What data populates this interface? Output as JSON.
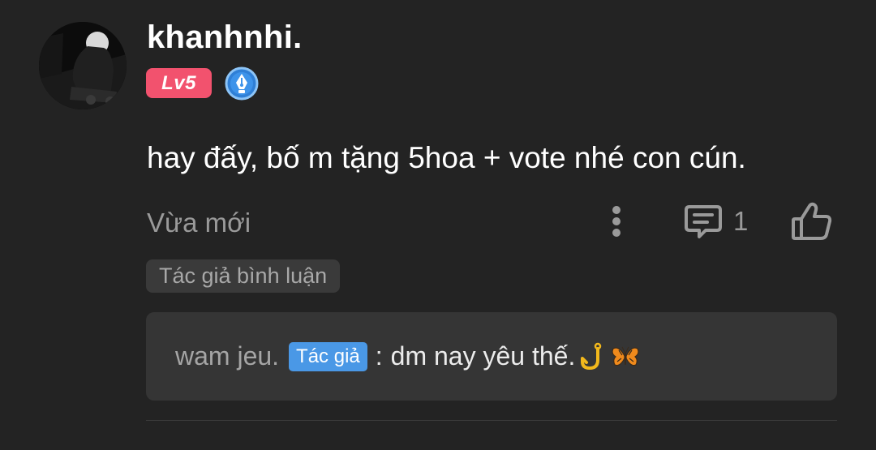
{
  "comment": {
    "username": "khanhnhi.",
    "level": "Lv5",
    "text": "hay đấy, bố m tặng 5hoa + vote nhé con cún.",
    "timestamp": "Vừa mới",
    "reply_count": "1",
    "author_tag": "Tác giả bình luận"
  },
  "reply": {
    "author": "wam jeu.",
    "author_badge": "Tác giả",
    "separator": ":",
    "text": "dm nay yêu thế."
  },
  "colors": {
    "background": "#232323",
    "level_badge": "#f2526e",
    "author_chip": "#4a98e6",
    "reply_box": "#353535"
  },
  "icons": {
    "writer_badge": "pen-nib-badge-icon",
    "more": "more-vertical-icon",
    "reply": "comment-icon",
    "like": "thumbs-up-icon",
    "emoji_1": "hook-emoji-icon",
    "emoji_2": "butterfly-emoji-icon"
  }
}
